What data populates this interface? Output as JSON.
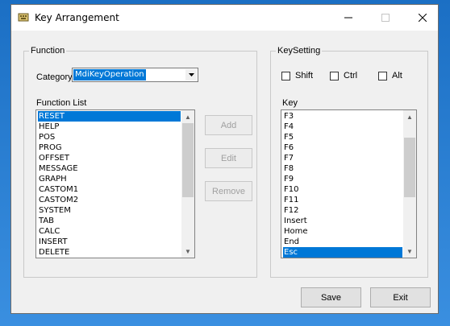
{
  "window": {
    "title": "Key Arrangement",
    "icon": "keyboard-icon"
  },
  "function_group": {
    "legend": "Function",
    "category_label": "Category",
    "category_value": "MdiKeyOperation",
    "function_list_label": "Function List",
    "items": [
      "RESET",
      "HELP",
      "POS",
      "PROG",
      "OFFSET",
      "MESSAGE",
      "GRAPH",
      "CASTOM1",
      "CASTOM2",
      "SYSTEM",
      "TAB",
      "CALC",
      "INSERT",
      "DELETE"
    ],
    "selected": "RESET"
  },
  "buttons": {
    "add": "Add",
    "edit": "Edit",
    "remove": "Remove",
    "save": "Save",
    "exit": "Exit"
  },
  "keysetting_group": {
    "legend": "KeySetting",
    "shift": "Shift",
    "ctrl": "Ctrl",
    "alt": "Alt",
    "key_label": "Key",
    "keys": [
      "F3",
      "F4",
      "F5",
      "F6",
      "F7",
      "F8",
      "F9",
      "F10",
      "F11",
      "F12",
      "Insert",
      "Home",
      "End",
      "Esc"
    ],
    "selected": "Esc"
  },
  "colors": {
    "selection": "#0078d7",
    "desktop": "#1e78d0"
  }
}
